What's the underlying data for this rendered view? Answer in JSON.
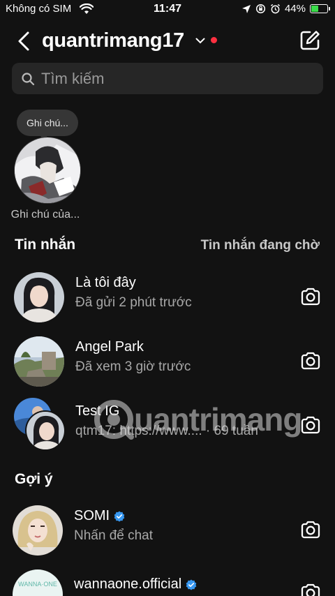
{
  "status_bar": {
    "carrier": "Không có SIM",
    "time": "11:47",
    "battery": "44%",
    "battery_level": 0.44
  },
  "header": {
    "username": "quantrimang17"
  },
  "search": {
    "placeholder": "Tìm kiếm"
  },
  "note": {
    "bubble": "Ghi chú...",
    "label": "Ghi chú của..."
  },
  "messages_section": {
    "title": "Tin nhắn",
    "pending_link": "Tin nhắn đang chờ"
  },
  "messages": [
    {
      "name": "Là tôi đây",
      "sub": "Đã gửi 2 phút trước"
    },
    {
      "name": "Angel Park",
      "sub": "Đã xem 3 giờ trước"
    },
    {
      "name": "Test IG",
      "sub": "qtm17: https://www.... · 69 tuần"
    }
  ],
  "suggestions_section": {
    "title": "Gợi ý"
  },
  "suggestions": [
    {
      "name": "SOMI",
      "sub": "Nhấn để chat",
      "verified": true
    },
    {
      "name": "wannaone.official",
      "verified": true,
      "avatar_text": "WANNA·ONE"
    }
  ],
  "watermark": {
    "text": "uantrimang"
  },
  "colors": {
    "background": "#121212",
    "search_bg": "#262626",
    "notification_dot": "#ff3040",
    "verified": "#3797f0",
    "battery": "#3adb4a"
  }
}
